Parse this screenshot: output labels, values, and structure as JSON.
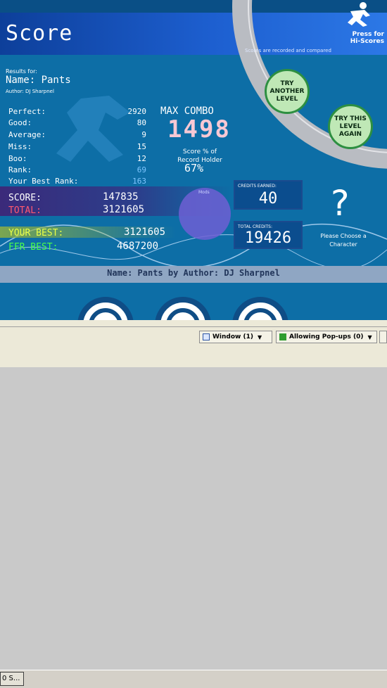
{
  "screen": {
    "title": "Score",
    "hiscore_prompt": "Press for\nHi-Scores",
    "hiscore_info": "Scores are recorded and compared"
  },
  "song": {
    "results_for": "Results for:",
    "name": "Name: Pants",
    "author": "Author: DJ Sharpnel",
    "footer": "Name: Pants by Author: DJ Sharpnel"
  },
  "stats": [
    {
      "label": "Perfect:",
      "value": "2920"
    },
    {
      "label": "Good:",
      "value": "80"
    },
    {
      "label": "Average:",
      "value": "9"
    },
    {
      "label": "Miss:",
      "value": "15"
    },
    {
      "label": "Boo:",
      "value": "12"
    },
    {
      "label": "Rank:",
      "value": "69"
    },
    {
      "label": "Your Best Rank:",
      "value": "163"
    }
  ],
  "combo": {
    "label": "MAX COMBO",
    "value": "1498",
    "score_pct_label": "Score % of Record Holder",
    "score_pct_value": "67%"
  },
  "scores": {
    "score_label": "SCORE:",
    "score_value": "147835",
    "total_label": "TOTAL:",
    "total_value": "3121605",
    "your_best_label": "YOUR BEST:",
    "your_best_value": "3121605",
    "ffr_best_label": "FFR BEST:",
    "ffr_best_value": "4687200"
  },
  "modifier": {
    "label": "Mods"
  },
  "credits": {
    "earned_label": "CREDITS EARNED:",
    "earned_value": "40",
    "total_label": "TOTAL CREDITS:",
    "total_value": "19426"
  },
  "character": {
    "symbol": "?",
    "prompt": "Please Choose a Character"
  },
  "buttons": {
    "try_another": "TRY ANOTHER LEVEL",
    "try_this": "TRY THIS LEVEL AGAIN"
  },
  "statusbar": {
    "window": "Window (1)",
    "popups": "Allowing Pop-ups (0)"
  },
  "taskbar": {
    "item": "0 S..."
  },
  "colors": {
    "background": "#0d6ea6",
    "title_band": "#1d5fd0",
    "total_red": "#ff5870",
    "your_best_yellow": "#eaff46",
    "ffr_best_green": "#4cff4c",
    "max_combo_pink": "#f7c8d4",
    "button_green": "#bfe8b6"
  }
}
